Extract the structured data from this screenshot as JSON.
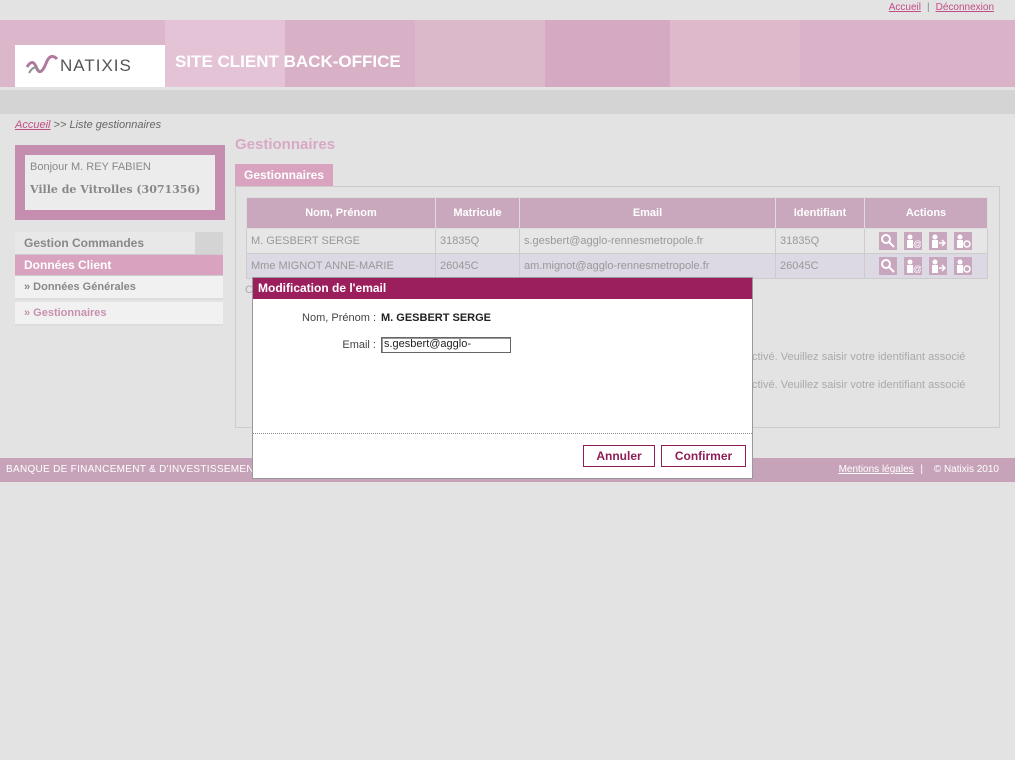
{
  "top_links": {
    "home": "Accueil",
    "separator": "|",
    "logout": "Déconnexion"
  },
  "header": {
    "logo_text": "NATIXIS",
    "site_title": "SITE CLIENT BACK-OFFICE"
  },
  "breadcrumb": {
    "home": "Accueil",
    "separator": ">>",
    "current": "Liste gestionnaires"
  },
  "user": {
    "greeting": "Bonjour M. REY FABIEN",
    "company": "Ville de Vitrolles (3071356)"
  },
  "sidebar": {
    "items": [
      {
        "label": "Gestion Commandes"
      },
      {
        "label": "Données Client"
      },
      {
        "label": "» Données Générales"
      },
      {
        "label": "» Gestionnaires"
      }
    ]
  },
  "main": {
    "title": "Gestionnaires",
    "tab": "Gestionnaires",
    "table": {
      "headers": [
        "Nom, Prénom",
        "Matricule",
        "Email",
        "Identifiant",
        "Actions"
      ],
      "rows": [
        [
          "M. GESBERT SERGE",
          "31835Q",
          "s.gesbert@agglo-rennesmetropole.fr",
          "31835Q"
        ],
        [
          "Mme MIGNOT ANNE-MARIE",
          "26045C",
          "am.mignot@agglo-rennesmetropole.fr",
          "26045C"
        ]
      ]
    },
    "partial_text_1": "C",
    "partial_text_2": "ctivé. Veuillez saisir votre identifiant associé",
    "partial_text_3": "ctivé. Veuillez saisir votre identifiant associé"
  },
  "footer": {
    "left": "BANQUE DE FINANCEMENT & D'INVESTISSEMEN",
    "legal": "Mentions légales",
    "separator": "|",
    "copyright": "© Natixis 2010"
  },
  "modal": {
    "title": "Modification de l'email",
    "name_label": "Nom, Prénom :",
    "name_value": "M. GESBERT SERGE",
    "email_label": "Email :",
    "email_value": "s.gesbert@agglo-rennesr",
    "cancel": "Annuler",
    "confirm": "Confirmer"
  },
  "colors": {
    "accent": "#9c1f5d",
    "pink": "#d9a3c0",
    "header_pink": "#dcb6ca"
  },
  "icons": [
    "search-icon",
    "user-email-icon",
    "user-logout-icon",
    "user-refresh-icon"
  ]
}
